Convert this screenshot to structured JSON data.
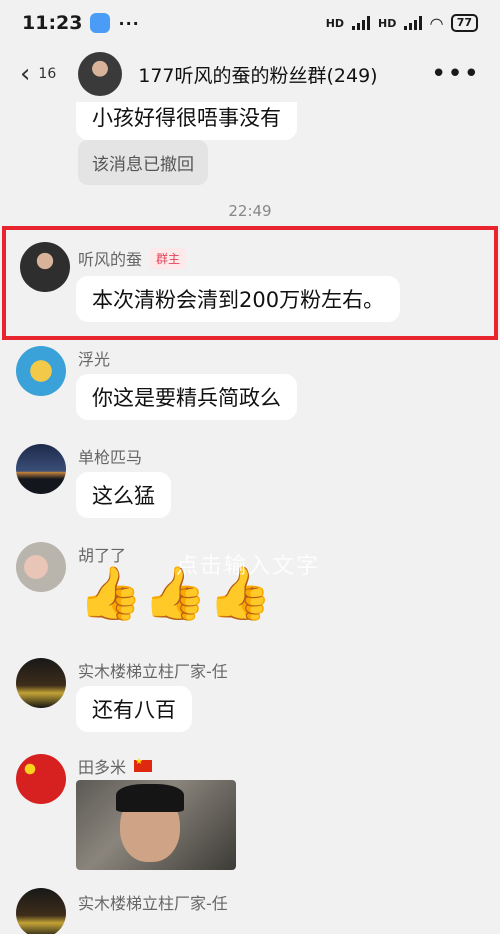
{
  "status_bar": {
    "time": "11:23",
    "more": "···",
    "network_1": "HD",
    "network_2": "HD",
    "battery": "77"
  },
  "header": {
    "back_count": "16",
    "title": "177听风的蚕的粉丝群(249)"
  },
  "chat": {
    "cut_message": "小孩好得很唔事没有",
    "recalled_notice": "该消息已撤回",
    "timestamp": "22:49",
    "watermark": "点击输入文字",
    "messages": [
      {
        "sender": "听风的蚕",
        "badge": "群主",
        "text": "本次清粉会清到200万粉左右。"
      },
      {
        "sender": "浮光",
        "text": "你这是要精兵简政么"
      },
      {
        "sender": "单枪匹马",
        "text": "这么猛"
      },
      {
        "sender": "胡了了",
        "text": "👍👍👍"
      },
      {
        "sender": "实木楼梯立柱厂家-任",
        "text": "还有八百"
      },
      {
        "sender": "田多米",
        "text": ""
      },
      {
        "sender": "实木楼梯立柱厂家-任",
        "text": ""
      }
    ]
  },
  "colors": {
    "highlight": "#e8242f",
    "owner_badge_text": "#e0445a",
    "background": "#f1f1f1"
  }
}
